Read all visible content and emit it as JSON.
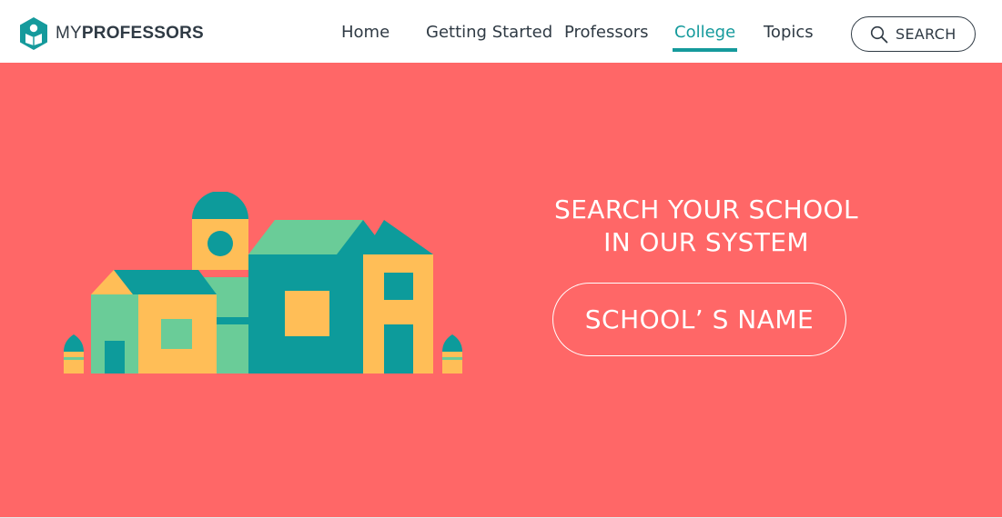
{
  "header": {
    "logo": {
      "prefix": "MY",
      "suffix": "PROFESSORS",
      "icon": "hexagon-book-icon"
    },
    "nav": [
      {
        "label": "Home",
        "active": false
      },
      {
        "label": "Getting Started",
        "active": false
      },
      {
        "label": "Professors",
        "active": false
      },
      {
        "label": "College",
        "active": true
      },
      {
        "label": "Topics",
        "active": false
      }
    ],
    "search": {
      "label": "SEARCH",
      "icon": "search-icon"
    }
  },
  "hero": {
    "title_line1": "SEARCH YOUR SCHOOL",
    "title_line2": "IN OUR SYSTEM",
    "school_button_label": "SCHOOL’ S NAME",
    "illustration": "school-building-illustration"
  },
  "colors": {
    "brand": "#159a9c",
    "hero_background": "#ff6767",
    "text_dark": "#2f3a44",
    "illustration_teal": "#0d9b9b",
    "illustration_green": "#6acc98",
    "illustration_yellow": "#ffbe57"
  }
}
